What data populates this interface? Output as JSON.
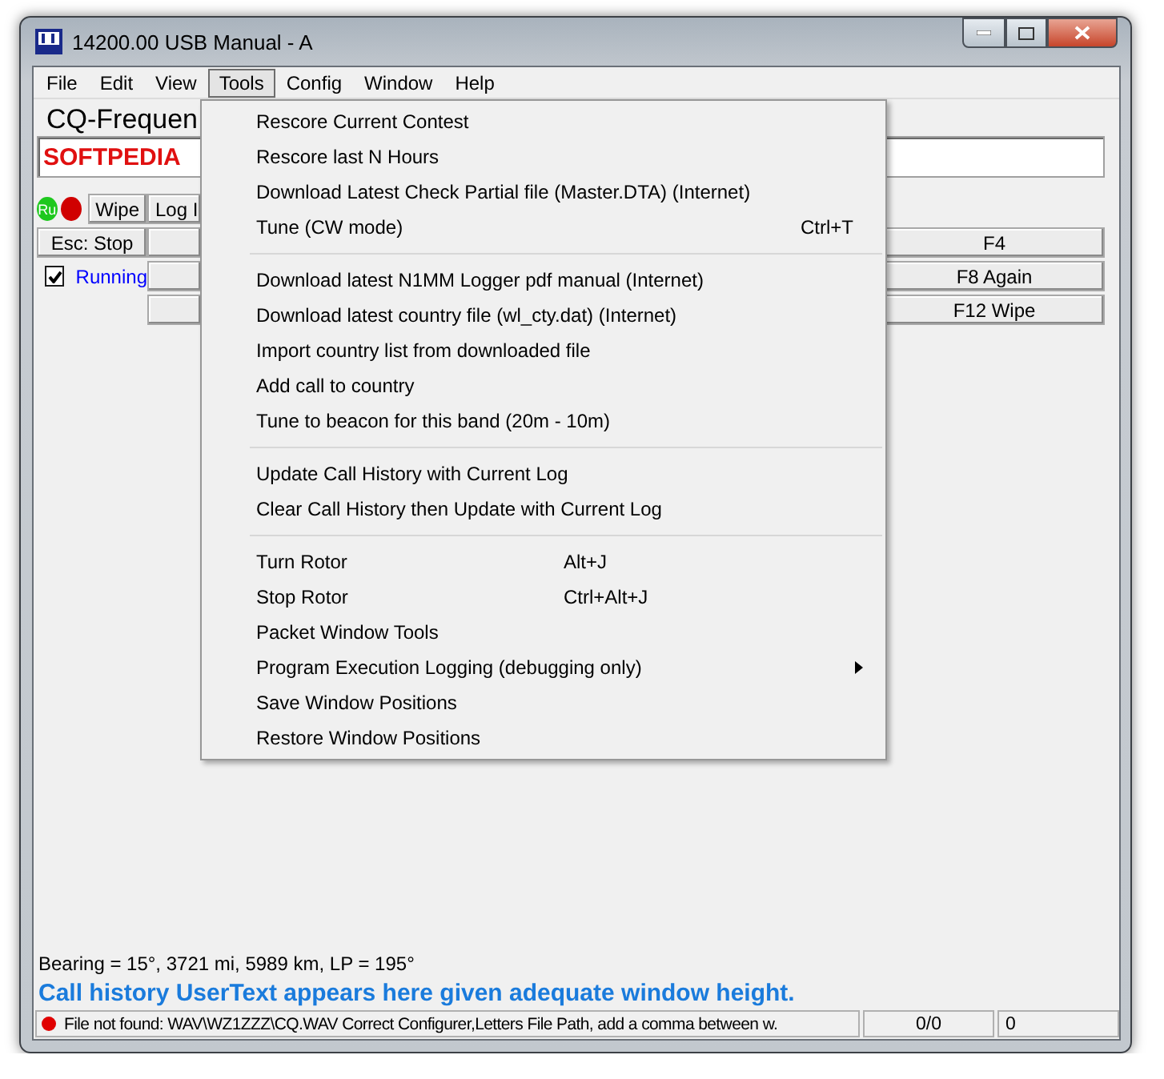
{
  "window": {
    "title": "14200.00 USB Manual - A"
  },
  "menubar": [
    {
      "label": "File",
      "selected": false
    },
    {
      "label": "Edit",
      "selected": false
    },
    {
      "label": "View",
      "selected": false
    },
    {
      "label": "Tools",
      "selected": true
    },
    {
      "label": "Config",
      "selected": false
    },
    {
      "label": "Window",
      "selected": false
    },
    {
      "label": "Help",
      "selected": false
    }
  ],
  "cq_frequency": {
    "label": "CQ-Frequen",
    "value": "SOFTPEDIA"
  },
  "indicator": {
    "label": "Ru"
  },
  "wipe_button": "Wipe",
  "log_button": "Log I",
  "stop_button": "Esc: Stop",
  "running": {
    "label": "Running",
    "checked": true
  },
  "function_keys": [
    "F4",
    "F8 Again",
    "F12 Wipe"
  ],
  "tools_menu": [
    [
      {
        "label": "Rescore Current Contest",
        "kind": "command"
      },
      {
        "label": "Rescore last N Hours",
        "kind": "command"
      },
      {
        "label": "Download Latest Check Partial file (Master.DTA) (Internet)",
        "kind": "command"
      },
      {
        "label": "Tune (CW mode)",
        "kind": "command",
        "shortcut": "Ctrl+T"
      }
    ],
    [
      {
        "label": "Download latest N1MM Logger pdf manual (Internet)",
        "kind": "command"
      },
      {
        "label": "Download latest country file (wl_cty.dat) (Internet)",
        "kind": "command"
      },
      {
        "label": "Import country list from downloaded file",
        "kind": "command"
      },
      {
        "label": "Add call to country",
        "kind": "command"
      },
      {
        "label": "Tune to beacon for this band  (20m - 10m)",
        "kind": "command"
      }
    ],
    [
      {
        "label": "Update Call History with Current Log",
        "kind": "command"
      },
      {
        "label": "Clear Call History then Update with Current Log",
        "kind": "command"
      }
    ],
    [
      {
        "label": "Turn Rotor",
        "kind": "command",
        "shortcut": "Alt+J"
      },
      {
        "label": "Stop Rotor",
        "kind": "command",
        "shortcut": "Ctrl+Alt+J"
      },
      {
        "label": "Packet Window Tools",
        "kind": "command"
      },
      {
        "label": "Program Execution Logging (debugging only)",
        "kind": "submenu"
      },
      {
        "label": "Save Window Positions",
        "kind": "command"
      },
      {
        "label": "Restore Window Positions",
        "kind": "command"
      }
    ]
  ],
  "bearing": "Bearing = 15°, 3721  mi, 5989 km, LP = 195°",
  "user_text": "Call history UserText appears here given adequate window height.",
  "status_bar": {
    "message": "File not found: WAV\\WZ1ZZZ\\CQ.WAV Correct Configurer,Letters File Path, add a comma between w.",
    "count": "0/0",
    "value": "0"
  }
}
